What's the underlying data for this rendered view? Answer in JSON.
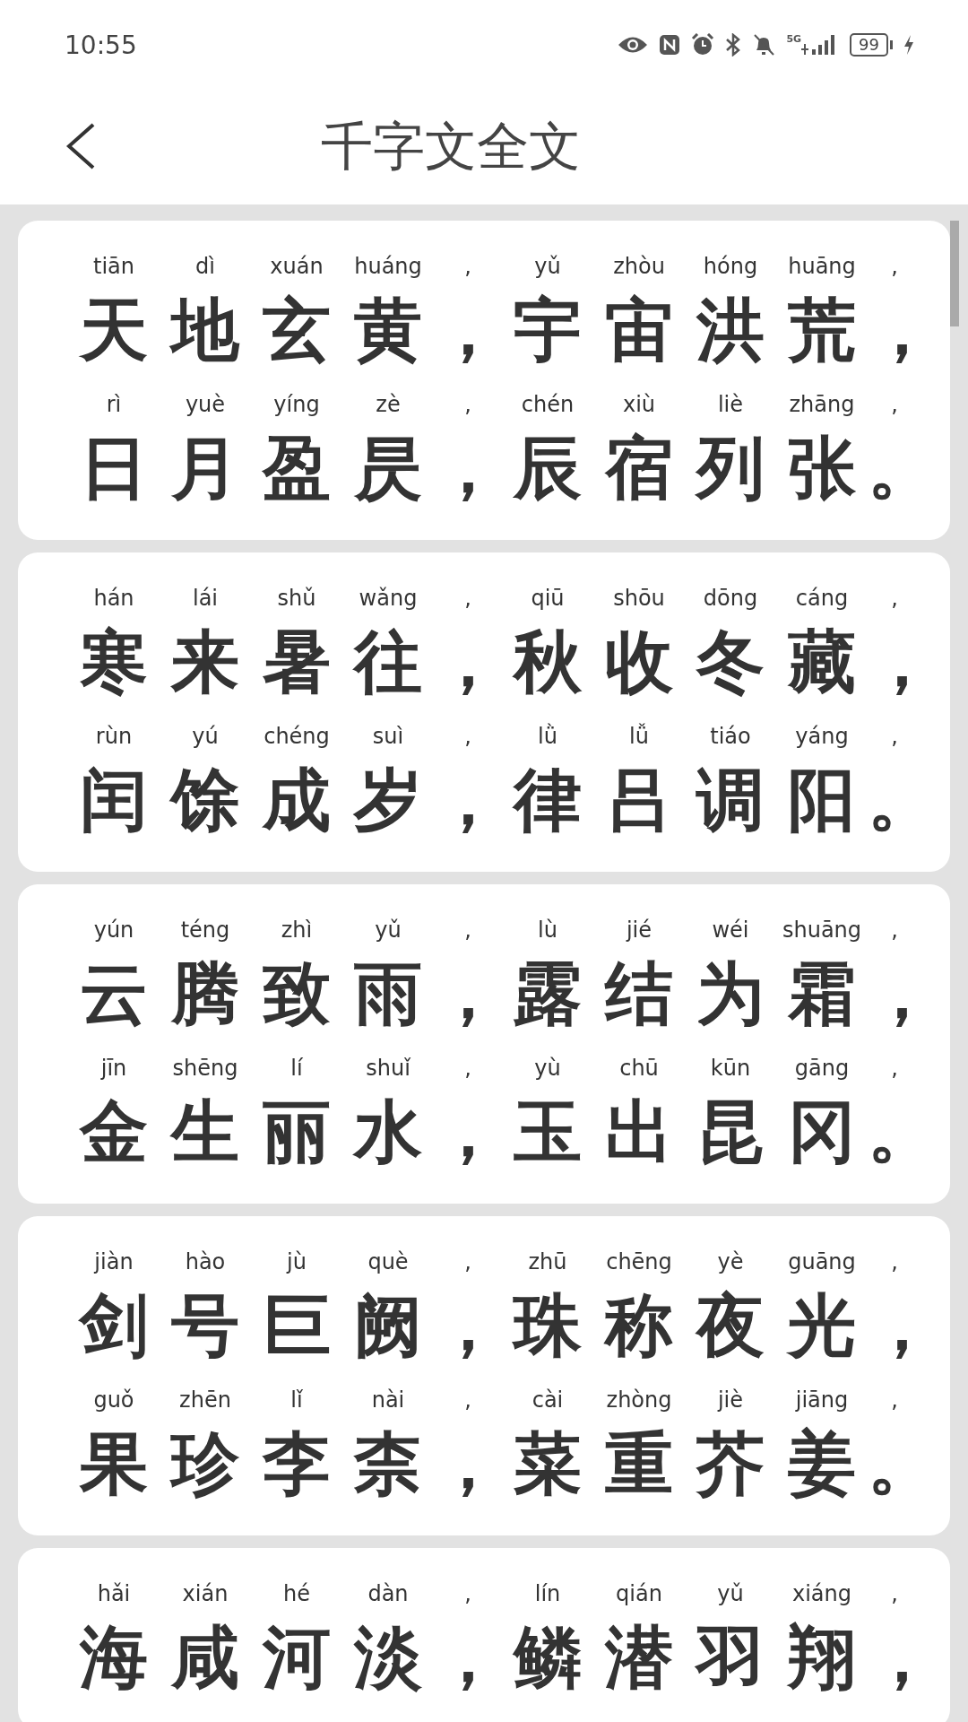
{
  "status_bar": {
    "time": "10:55",
    "network": "5G",
    "battery": "99"
  },
  "header": {
    "title": "千字文全文"
  },
  "cards": [
    {
      "lines": [
        {
          "cells": [
            {
              "pinyin": "tiān",
              "hanzi": "天"
            },
            {
              "pinyin": "dì",
              "hanzi": "地"
            },
            {
              "pinyin": "xuán",
              "hanzi": "玄"
            },
            {
              "pinyin": "huáng",
              "hanzi": "黄"
            },
            {
              "pinyin": ",",
              "hanzi": "，"
            },
            {
              "pinyin": "yǔ",
              "hanzi": "宇"
            },
            {
              "pinyin": "zhòu",
              "hanzi": "宙"
            },
            {
              "pinyin": "hóng",
              "hanzi": "洪"
            },
            {
              "pinyin": "huāng",
              "hanzi": "荒"
            },
            {
              "pinyin": ",",
              "hanzi": "，"
            }
          ]
        },
        {
          "cells": [
            {
              "pinyin": "rì",
              "hanzi": "日"
            },
            {
              "pinyin": "yuè",
              "hanzi": "月"
            },
            {
              "pinyin": "yíng",
              "hanzi": "盈"
            },
            {
              "pinyin": "zè",
              "hanzi": "昃"
            },
            {
              "pinyin": ",",
              "hanzi": "，"
            },
            {
              "pinyin": "chén",
              "hanzi": "辰"
            },
            {
              "pinyin": "xiù",
              "hanzi": "宿"
            },
            {
              "pinyin": "liè",
              "hanzi": "列"
            },
            {
              "pinyin": "zhāng",
              "hanzi": "张"
            },
            {
              "pinyin": ",",
              "hanzi": "。"
            }
          ]
        }
      ]
    },
    {
      "lines": [
        {
          "cells": [
            {
              "pinyin": "hán",
              "hanzi": "寒"
            },
            {
              "pinyin": "lái",
              "hanzi": "来"
            },
            {
              "pinyin": "shǔ",
              "hanzi": "暑"
            },
            {
              "pinyin": "wǎng",
              "hanzi": "往"
            },
            {
              "pinyin": ",",
              "hanzi": "，"
            },
            {
              "pinyin": "qiū",
              "hanzi": "秋"
            },
            {
              "pinyin": "shōu",
              "hanzi": "收"
            },
            {
              "pinyin": "dōng",
              "hanzi": "冬"
            },
            {
              "pinyin": "cáng",
              "hanzi": "藏"
            },
            {
              "pinyin": ",",
              "hanzi": "，"
            }
          ]
        },
        {
          "cells": [
            {
              "pinyin": "rùn",
              "hanzi": "闰"
            },
            {
              "pinyin": "yú",
              "hanzi": "馀"
            },
            {
              "pinyin": "chéng",
              "hanzi": "成"
            },
            {
              "pinyin": "suì",
              "hanzi": "岁"
            },
            {
              "pinyin": ",",
              "hanzi": "，"
            },
            {
              "pinyin": "lǜ",
              "hanzi": "律"
            },
            {
              "pinyin": "lǚ",
              "hanzi": "吕"
            },
            {
              "pinyin": "tiáo",
              "hanzi": "调"
            },
            {
              "pinyin": "yáng",
              "hanzi": "阳"
            },
            {
              "pinyin": ",",
              "hanzi": "。"
            }
          ]
        }
      ]
    },
    {
      "lines": [
        {
          "cells": [
            {
              "pinyin": "yún",
              "hanzi": "云"
            },
            {
              "pinyin": "téng",
              "hanzi": "腾"
            },
            {
              "pinyin": "zhì",
              "hanzi": "致"
            },
            {
              "pinyin": "yǔ",
              "hanzi": "雨"
            },
            {
              "pinyin": ",",
              "hanzi": "，"
            },
            {
              "pinyin": "lù",
              "hanzi": "露"
            },
            {
              "pinyin": "jié",
              "hanzi": "结"
            },
            {
              "pinyin": "wéi",
              "hanzi": "为"
            },
            {
              "pinyin": "shuāng",
              "hanzi": "霜"
            },
            {
              "pinyin": ",",
              "hanzi": "，"
            }
          ]
        },
        {
          "cells": [
            {
              "pinyin": "jīn",
              "hanzi": "金"
            },
            {
              "pinyin": "shēng",
              "hanzi": "生"
            },
            {
              "pinyin": "lí",
              "hanzi": "丽"
            },
            {
              "pinyin": "shuǐ",
              "hanzi": "水"
            },
            {
              "pinyin": ",",
              "hanzi": "，"
            },
            {
              "pinyin": "yù",
              "hanzi": "玉"
            },
            {
              "pinyin": "chū",
              "hanzi": "出"
            },
            {
              "pinyin": "kūn",
              "hanzi": "昆"
            },
            {
              "pinyin": "gāng",
              "hanzi": "冈"
            },
            {
              "pinyin": ",",
              "hanzi": "。"
            }
          ]
        }
      ]
    },
    {
      "lines": [
        {
          "cells": [
            {
              "pinyin": "jiàn",
              "hanzi": "剑"
            },
            {
              "pinyin": "hào",
              "hanzi": "号"
            },
            {
              "pinyin": "jù",
              "hanzi": "巨"
            },
            {
              "pinyin": "què",
              "hanzi": "阙"
            },
            {
              "pinyin": ",",
              "hanzi": "，"
            },
            {
              "pinyin": "zhū",
              "hanzi": "珠"
            },
            {
              "pinyin": "chēng",
              "hanzi": "称"
            },
            {
              "pinyin": "yè",
              "hanzi": "夜"
            },
            {
              "pinyin": "guāng",
              "hanzi": "光"
            },
            {
              "pinyin": ",",
              "hanzi": "，"
            }
          ]
        },
        {
          "cells": [
            {
              "pinyin": "guǒ",
              "hanzi": "果"
            },
            {
              "pinyin": "zhēn",
              "hanzi": "珍"
            },
            {
              "pinyin": "lǐ",
              "hanzi": "李"
            },
            {
              "pinyin": "nài",
              "hanzi": "柰"
            },
            {
              "pinyin": ",",
              "hanzi": "，"
            },
            {
              "pinyin": "cài",
              "hanzi": "菜"
            },
            {
              "pinyin": "zhòng",
              "hanzi": "重"
            },
            {
              "pinyin": "jiè",
              "hanzi": "芥"
            },
            {
              "pinyin": "jiāng",
              "hanzi": "姜"
            },
            {
              "pinyin": ",",
              "hanzi": "。"
            }
          ]
        }
      ]
    },
    {
      "lines": [
        {
          "cells": [
            {
              "pinyin": "hǎi",
              "hanzi": "海"
            },
            {
              "pinyin": "xián",
              "hanzi": "咸"
            },
            {
              "pinyin": "hé",
              "hanzi": "河"
            },
            {
              "pinyin": "dàn",
              "hanzi": "淡"
            },
            {
              "pinyin": ",",
              "hanzi": "，"
            },
            {
              "pinyin": "lín",
              "hanzi": "鳞"
            },
            {
              "pinyin": "qián",
              "hanzi": "潜"
            },
            {
              "pinyin": "yǔ",
              "hanzi": "羽"
            },
            {
              "pinyin": "xiáng",
              "hanzi": "翔"
            },
            {
              "pinyin": ",",
              "hanzi": "，"
            }
          ]
        }
      ]
    }
  ]
}
